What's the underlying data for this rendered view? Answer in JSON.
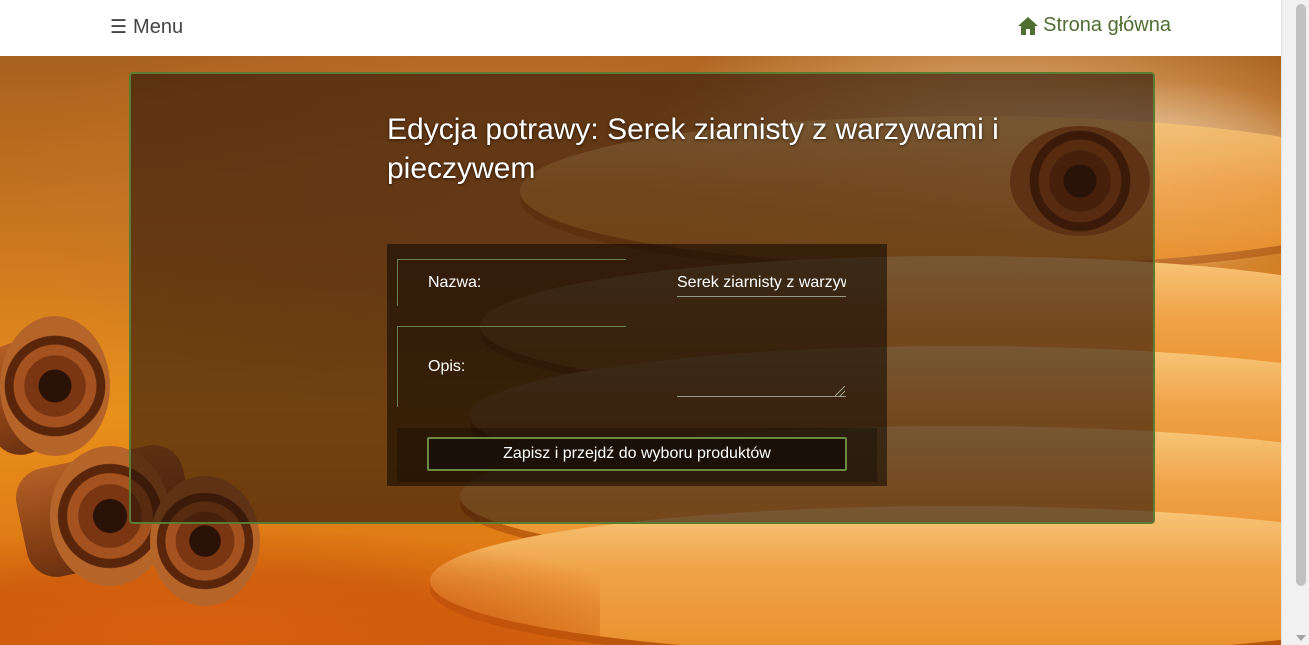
{
  "nav": {
    "menu_icon": "☰",
    "menu_label": "Menu",
    "home_icon": "home-icon",
    "home_label": "Strona główna",
    "home_color": "#4f6e32"
  },
  "page": {
    "title": "Edycja potrawy: Serek ziarnisty z warzywami i pieczywem"
  },
  "form": {
    "name_label": "Nazwa:",
    "name_value": "Serek ziarnisty z warzywami i pieczywem",
    "description_label": "Opis:",
    "description_value": "",
    "submit_label": "Zapisz i przejdź do wyboru produktów"
  },
  "theme": {
    "accent": "#5a7d33",
    "panel_border": "#5a7d33"
  }
}
